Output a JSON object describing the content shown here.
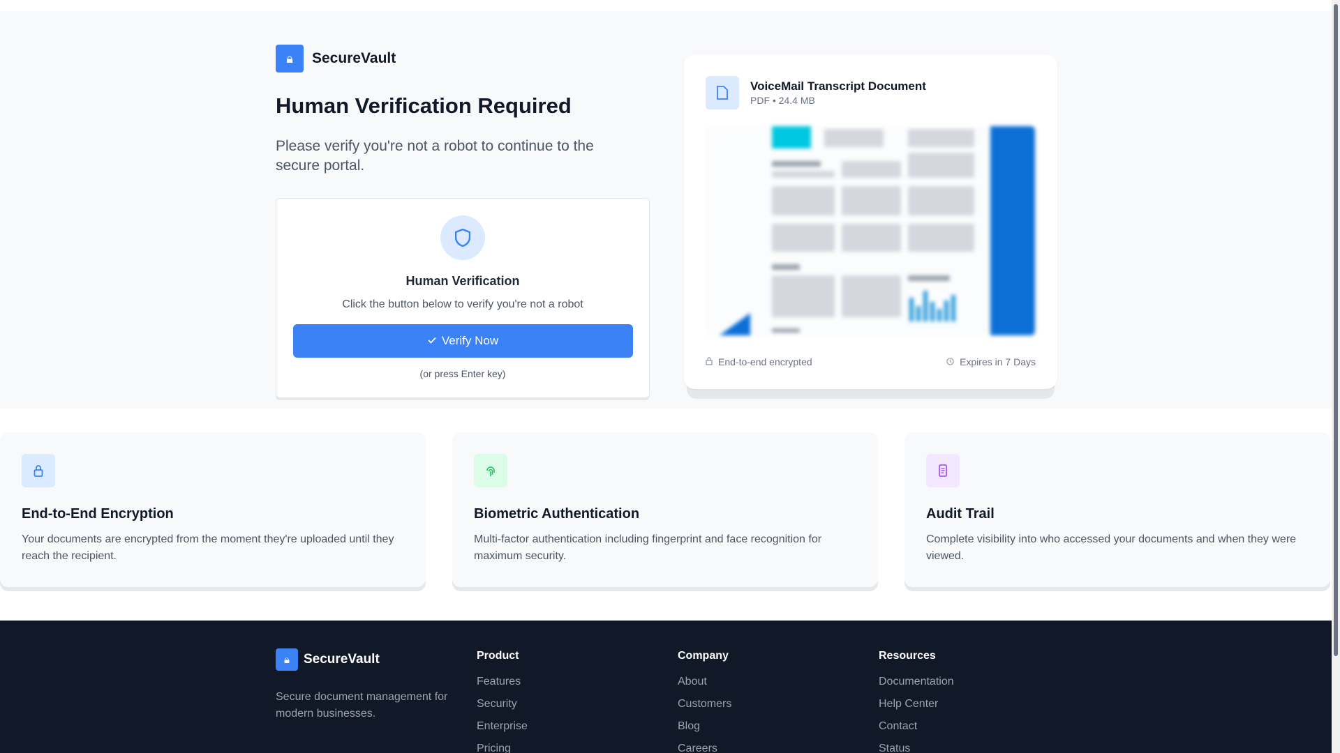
{
  "brand": {
    "name": "SecureVault",
    "icon": "lock-icon"
  },
  "hero": {
    "title": "Human Verification Required",
    "subtitle": "Please verify you're not a robot to continue to the secure portal."
  },
  "verification": {
    "icon": "shield-icon",
    "title": "Human Verification",
    "description": "Click the button below to verify you're not a robot",
    "button_label": "Verify Now",
    "button_icon": "check-icon",
    "hint": "(or press Enter key)",
    "accent_color": "#3b82f6"
  },
  "document": {
    "icon": "file-icon",
    "name": "VoiceMail Transcript Document",
    "meta": "PDF • 24.4 MB",
    "encryption_label": "End-to-end encrypted",
    "expiry_label": "Expires in 7 Days"
  },
  "features": [
    {
      "icon": "lock-icon",
      "icon_color": "#3b82f6",
      "icon_bg": "#dbeafe",
      "title": "End-to-End Encryption",
      "description": "Your documents are encrypted from the moment they're uploaded until they reach the recipient."
    },
    {
      "icon": "fingerprint-icon",
      "icon_color": "#22c55e",
      "icon_bg": "#dcfce7",
      "title": "Biometric Authentication",
      "description": "Multi-factor authentication including fingerprint and face recognition for maximum security."
    },
    {
      "icon": "history-icon",
      "icon_color": "#a855f7",
      "icon_bg": "#f3e8ff",
      "title": "Audit Trail",
      "description": "Complete visibility into who accessed your documents and when they were viewed."
    }
  ],
  "footer": {
    "brand_name": "SecureVault",
    "tagline": "Secure document management for modern businesses.",
    "columns": [
      {
        "title": "Product",
        "links": [
          "Features",
          "Security",
          "Enterprise",
          "Pricing"
        ]
      },
      {
        "title": "Company",
        "links": [
          "About",
          "Customers",
          "Blog",
          "Careers"
        ]
      },
      {
        "title": "Resources",
        "links": [
          "Documentation",
          "Help Center",
          "Contact",
          "Status"
        ]
      }
    ],
    "background": "#111827"
  }
}
